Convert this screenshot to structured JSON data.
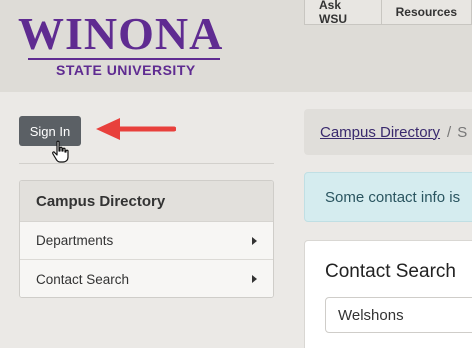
{
  "header": {
    "logo_top": "WINONA",
    "logo_sub": "STATE UNIVERSITY",
    "nav": [
      "Ask WSU",
      "Resources"
    ]
  },
  "signin": {
    "label": "Sign In"
  },
  "sidebar": {
    "title": "Campus Directory",
    "items": [
      {
        "label": "Departments"
      },
      {
        "label": "Contact Search"
      }
    ]
  },
  "breadcrumb": {
    "link": "Campus Directory",
    "sep": "/",
    "next": "S"
  },
  "alert": {
    "text": "Some contact info is"
  },
  "contact_search": {
    "title": "Contact Search",
    "input_value": "Welshons"
  },
  "icons": {
    "cursor": "hand-pointer-icon",
    "annotation": "red-arrow-icon",
    "caret": "caret-right-icon"
  },
  "colors": {
    "brand": "#5f2b91",
    "annotation": "#e8403c",
    "button": "#5b6065"
  }
}
